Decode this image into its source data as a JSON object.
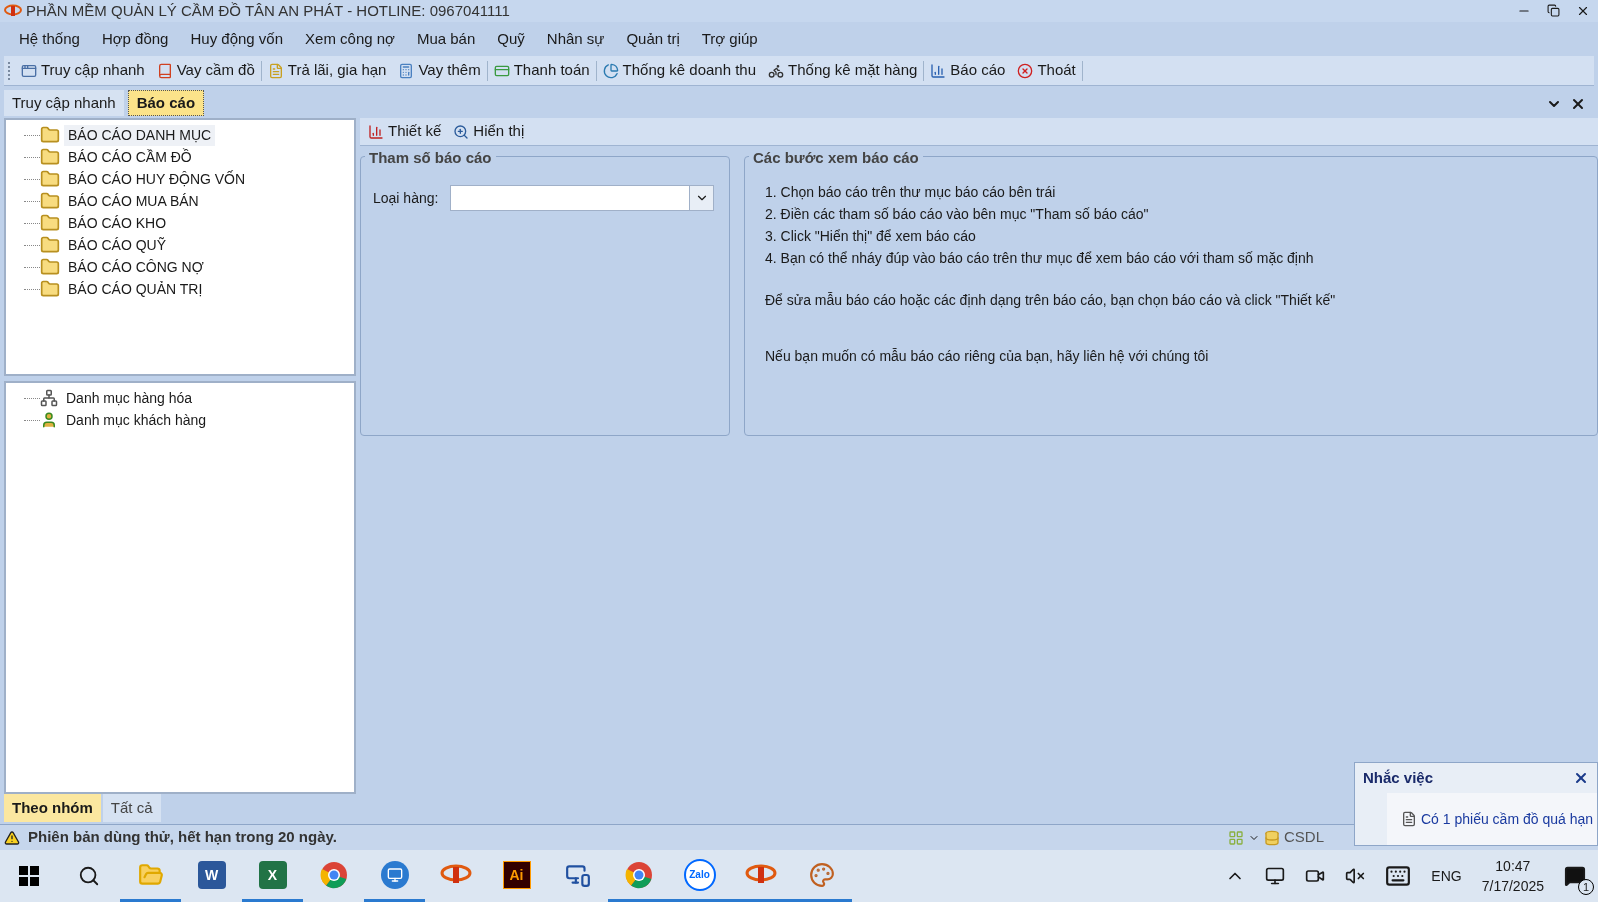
{
  "window": {
    "title": "PHẦN MỀM QUẢN LÝ CẦM ĐỒ TÂN AN PHÁT - HOTLINE: 0967041111"
  },
  "menu": [
    "Hệ thống",
    "Hợp đồng",
    "Huy động vốn",
    "Xem công nợ",
    "Mua bán",
    "Quỹ",
    "Nhân sự",
    "Quản trị",
    "Trợ giúp"
  ],
  "toolbar": [
    {
      "kind": "window",
      "label": "Truy cập nhanh"
    },
    {
      "kind": "book",
      "label": "Vay cầm đồ"
    },
    {
      "kind": "note",
      "label": "Trả lãi, gia hạn"
    },
    {
      "kind": "calc",
      "label": "Vay thêm"
    },
    {
      "kind": "pay",
      "label": "Thanh toán"
    },
    {
      "kind": "pie",
      "label": "Thống kê doanh thu"
    },
    {
      "kind": "bike",
      "label": "Thống kê mặt hàng"
    },
    {
      "kind": "chart",
      "label": "Báo cáo"
    },
    {
      "kind": "exit",
      "label": "Thoát"
    }
  ],
  "doc_tabs": [
    {
      "label": "Truy cập nhanh",
      "selected": false
    },
    {
      "label": "Báo cáo",
      "selected": true
    }
  ],
  "report_tree": [
    {
      "label": "BÁO CÁO DANH MỤC",
      "selected": true
    },
    {
      "label": "BÁO CÁO CẦM ĐỒ",
      "selected": false
    },
    {
      "label": "BÁO CÁO HUY ĐỘNG VỐN",
      "selected": false
    },
    {
      "label": "BÁO CÁO MUA BÁN",
      "selected": false
    },
    {
      "label": "BÁO CÁO KHO",
      "selected": false
    },
    {
      "label": "BÁO CÁO QUỸ",
      "selected": false
    },
    {
      "label": "BÁO CÁO CÔNG NỢ",
      "selected": false
    },
    {
      "label": "BÁO CÁO QUẢN TRỊ",
      "selected": false
    }
  ],
  "sub_tree": [
    {
      "kind": "hierarchy",
      "label": "Danh mục hàng hóa"
    },
    {
      "kind": "person",
      "label": "Danh mục khách hàng"
    }
  ],
  "panel_tabs": [
    {
      "label": "Theo nhóm",
      "selected": true
    },
    {
      "label": "Tất cả",
      "selected": false
    }
  ],
  "report_toolbar": [
    {
      "kind": "design",
      "label": "Thiết kế"
    },
    {
      "kind": "view",
      "label": "Hiển thị"
    }
  ],
  "params": {
    "title": "Tham số báo cáo",
    "fields": [
      {
        "label": "Loại hàng:"
      }
    ]
  },
  "steps": {
    "title": "Các bước xem báo cáo",
    "lines": [
      "1. Chọn báo cáo trên thư mục báo cáo bên trái",
      "2. Điền các tham số báo cáo vào bên mục \"Tham số báo cáo\"",
      "3. Click \"Hiển thị\" để xem báo cáo",
      "4. Bạn có thể nháy đúp vào báo cáo trên thư mục để xem báo cáo với tham số mặc định"
    ],
    "notes": [
      "Để sửa mẫu báo cáo hoặc các định dạng trên báo cáo, bạn chọn báo cáo và click \"Thiết kế\"",
      "Nếu bạn muốn có mẫu báo cáo riêng của bạn, hãy liên hệ với chúng tôi"
    ]
  },
  "status_bar": {
    "message": "Phiên bản dùng thử, hết hạn trong 20 ngày.",
    "db": "CSDL"
  },
  "reminder": {
    "title": "Nhắc việc",
    "item": "Có 1 phiếu cầm đồ quá hạn"
  },
  "taskbar": {
    "apps": [
      {
        "kind": "explorer",
        "running": true
      },
      {
        "kind": "word",
        "label": "W",
        "running": false
      },
      {
        "kind": "excel",
        "label": "X",
        "running": true
      },
      {
        "kind": "chrome",
        "running": false
      },
      {
        "kind": "remote",
        "running": true
      },
      {
        "kind": "logo",
        "running": false
      },
      {
        "kind": "ai",
        "label": "Ai",
        "running": false
      },
      {
        "kind": "network",
        "running": false
      },
      {
        "kind": "chrome",
        "running": true
      },
      {
        "kind": "zalo",
        "label": "Zalo",
        "running": true
      },
      {
        "kind": "logo",
        "running": true
      },
      {
        "kind": "paint",
        "running": true
      }
    ],
    "language": "ENG",
    "time": "10:47",
    "date": "7/17/2025",
    "notifications": "1"
  }
}
